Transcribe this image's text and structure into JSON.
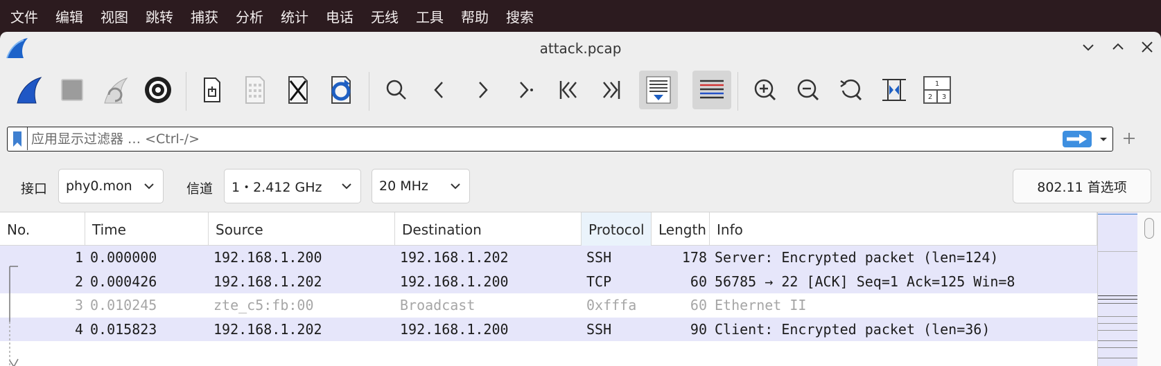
{
  "menubar": {
    "items": [
      "文件",
      "编辑",
      "视图",
      "跳转",
      "捕获",
      "分析",
      "统计",
      "电话",
      "无线",
      "工具",
      "帮助",
      "搜索"
    ]
  },
  "window": {
    "title": "attack.pcap"
  },
  "toolbar": {
    "icons": [
      "start-capture-icon",
      "stop-capture-icon",
      "restart-capture-icon",
      "capture-options-icon",
      "open-file-icon",
      "save-file-icon",
      "close-file-icon",
      "reload-file-icon",
      "find-packet-icon",
      "go-back-icon",
      "go-forward-icon",
      "go-to-packet-icon",
      "first-packet-icon",
      "last-packet-icon",
      "auto-scroll-icon",
      "colorize-icon",
      "zoom-in-icon",
      "zoom-out-icon",
      "normal-size-icon",
      "resize-columns-icon",
      "layout-icon"
    ]
  },
  "filter": {
    "placeholder": "应用显示过滤器 … <Ctrl-/>",
    "value": ""
  },
  "wireless": {
    "interface_label": "接口",
    "interface_value": "phy0.mon",
    "channel_label": "信道",
    "channel_value": "1・2.412 GHz",
    "width_value": "20 MHz",
    "prefs_button": "802.11 首选项"
  },
  "packet_list": {
    "columns": [
      "No.",
      "Time",
      "Source",
      "Destination",
      "Protocol",
      "Length",
      "Info"
    ],
    "rows": [
      {
        "no": "1",
        "time": "0.000000",
        "source": "192.168.1.200",
        "destination": "192.168.1.202",
        "protocol": "SSH",
        "length": "178",
        "info": "Server: Encrypted packet (len=124)",
        "style": "hl"
      },
      {
        "no": "2",
        "time": "0.000426",
        "source": "192.168.1.202",
        "destination": "192.168.1.200",
        "protocol": "TCP",
        "length": "60",
        "info": "56785 → 22 [ACK] Seq=1 Ack=125 Win=8",
        "style": "hl"
      },
      {
        "no": "3",
        "time": "0.010245",
        "source": "zte_c5:fb:00",
        "destination": "Broadcast",
        "protocol": "0xfffa",
        "length": "60",
        "info": "Ethernet II",
        "style": "dim"
      },
      {
        "no": "4",
        "time": "0.015823",
        "source": "192.168.1.202",
        "destination": "192.168.1.200",
        "protocol": "SSH",
        "length": "90",
        "info": "Client: Encrypted packet (len=36)",
        "style": "hl"
      }
    ]
  }
}
